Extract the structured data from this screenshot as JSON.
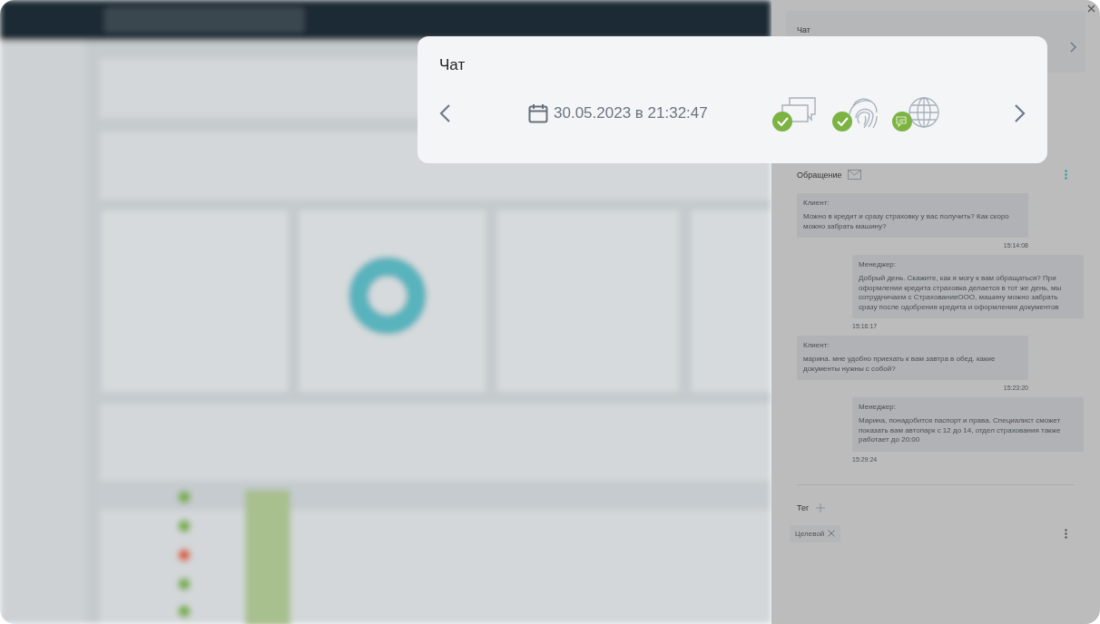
{
  "highlight_card": {
    "title": "Чат",
    "datetime": "30.05.2023 в 21:32:47",
    "indicators": [
      {
        "kind": "chats",
        "checked": true
      },
      {
        "kind": "fingerprint",
        "checked": true
      },
      {
        "kind": "globe",
        "checked": false
      }
    ]
  },
  "side_panel": {
    "section_title": "Чат",
    "request_title": "Обращение",
    "messages": [
      {
        "kind": "client",
        "author": "Клиент:",
        "text": "Можно в кредит и сразу страховку у вас получить? Как скоро можно забрать машину?",
        "time": "15:14:08"
      },
      {
        "kind": "manager",
        "author": "Менеджер:",
        "text": "Добрый день. Скажите, как я могу к вам обращаться? При оформлении кредита страховка делается в тот же день, мы сотрудничаем с СтрахованиеООО, машину можно забрать сразу после одобрения кредита и оформления документов",
        "time": "15:16:17"
      },
      {
        "kind": "client",
        "author": "Клиент:",
        "text": "марина. мне удобно приехать к вам завтра в обед. какие документы нужны с собой?",
        "time": "15:23:20"
      },
      {
        "kind": "manager",
        "author": "Менеджер:",
        "text": "Марина, понадобится паспорт и права. Специалист сможет показать вам автопарк с 12 до 14, отдел страхования также работает до 20:00",
        "time": "15:29:24"
      }
    ],
    "tag_label": "Тег",
    "tags": [
      "Целевой"
    ]
  }
}
